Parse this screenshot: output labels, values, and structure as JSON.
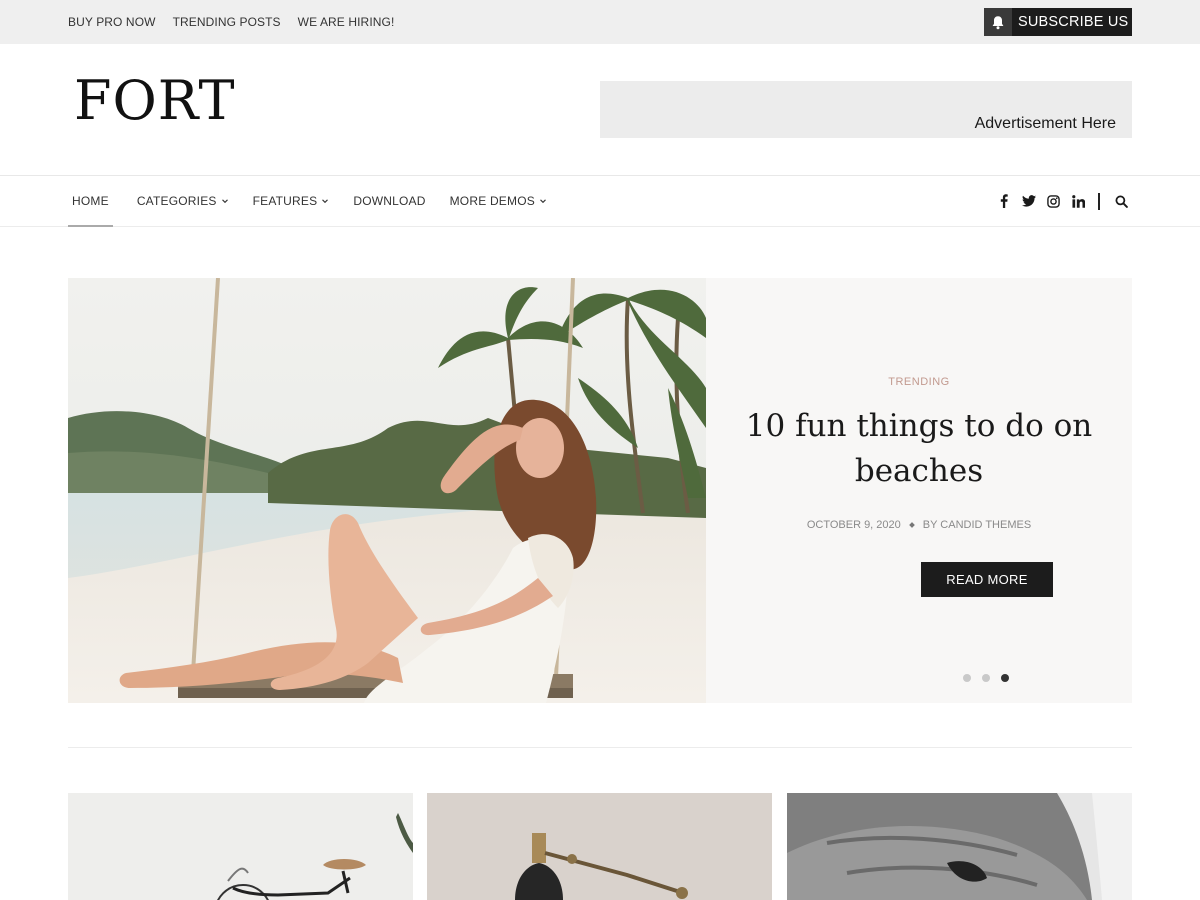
{
  "topbar": {
    "links": [
      "BUY PRO NOW",
      "TRENDING POSTS",
      "WE ARE HIRING!"
    ],
    "subscribe_label": "SUBSCRIBE US",
    "subscribe_icon": "bell-icon"
  },
  "header": {
    "logo": "FORT",
    "advertisement": "Advertisement Here"
  },
  "nav": {
    "items": [
      {
        "label": "HOME",
        "active": true,
        "dropdown": false
      },
      {
        "label": "CATEGORIES",
        "active": false,
        "dropdown": true
      },
      {
        "label": "FEATURES",
        "active": false,
        "dropdown": true
      },
      {
        "label": "DOWNLOAD",
        "active": false,
        "dropdown": false
      },
      {
        "label": "MORE DEMOS",
        "active": false,
        "dropdown": true
      }
    ],
    "social_icons": [
      "facebook-icon",
      "twitter-icon",
      "instagram-icon",
      "linkedin-icon"
    ],
    "search_icon": "search-icon"
  },
  "hero": {
    "category": "TRENDING",
    "title": "10 fun things to do on beaches",
    "date": "OCTOBER 9, 2020",
    "author": "BY CANDID THEMES",
    "button_label": "READ MORE",
    "slides_total": 3,
    "active_slide": 3
  },
  "colors": {
    "topbar_bg": "#efefef",
    "dark": "#1c1c1c",
    "category_accent": "#c29a8f",
    "hero_panel_bg": "#f8f7f6"
  }
}
